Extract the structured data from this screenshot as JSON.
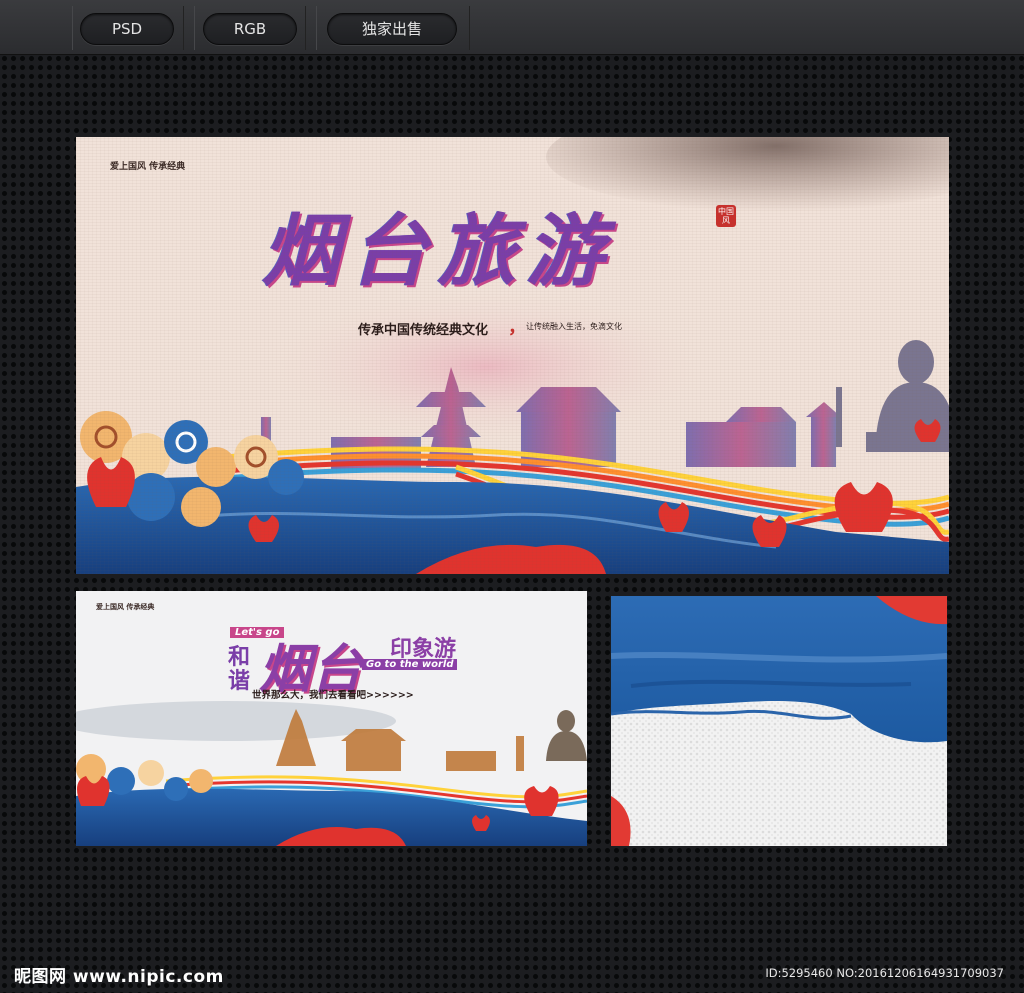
{
  "toolbar": {
    "tabs": [
      {
        "label": "PSD"
      },
      {
        "label": "RGB"
      },
      {
        "label": "独家出售"
      }
    ]
  },
  "poster_main": {
    "top_left_text": "爱上国风 传承经典",
    "title": "烟台旅游",
    "seal_text": "中国风",
    "tagline": "传承中国传统经典文化",
    "tagline_comma": "，",
    "tagline_small": "让传统融入生活，免滴文化"
  },
  "poster_small": {
    "top_left_text": "爱上国风 传承经典",
    "lets_go": "Let's go",
    "he": "和",
    "xie": "谐",
    "title": "烟台",
    "subtitle": "印象游",
    "go_world": "Go to the world",
    "slogan": "世界那么大，我们去看看吧>>>>>>"
  },
  "footer": {
    "logo": "昵图网 www.nipic.com",
    "id_text": "ID:5295460 NO:20161206164931709037"
  },
  "colors": {
    "background": "#1c1d20",
    "title_purple": "#7a3ea8",
    "title_pink": "#c8468a",
    "water_blue": "#1f5ca0",
    "lotus_red": "#e0332e"
  }
}
